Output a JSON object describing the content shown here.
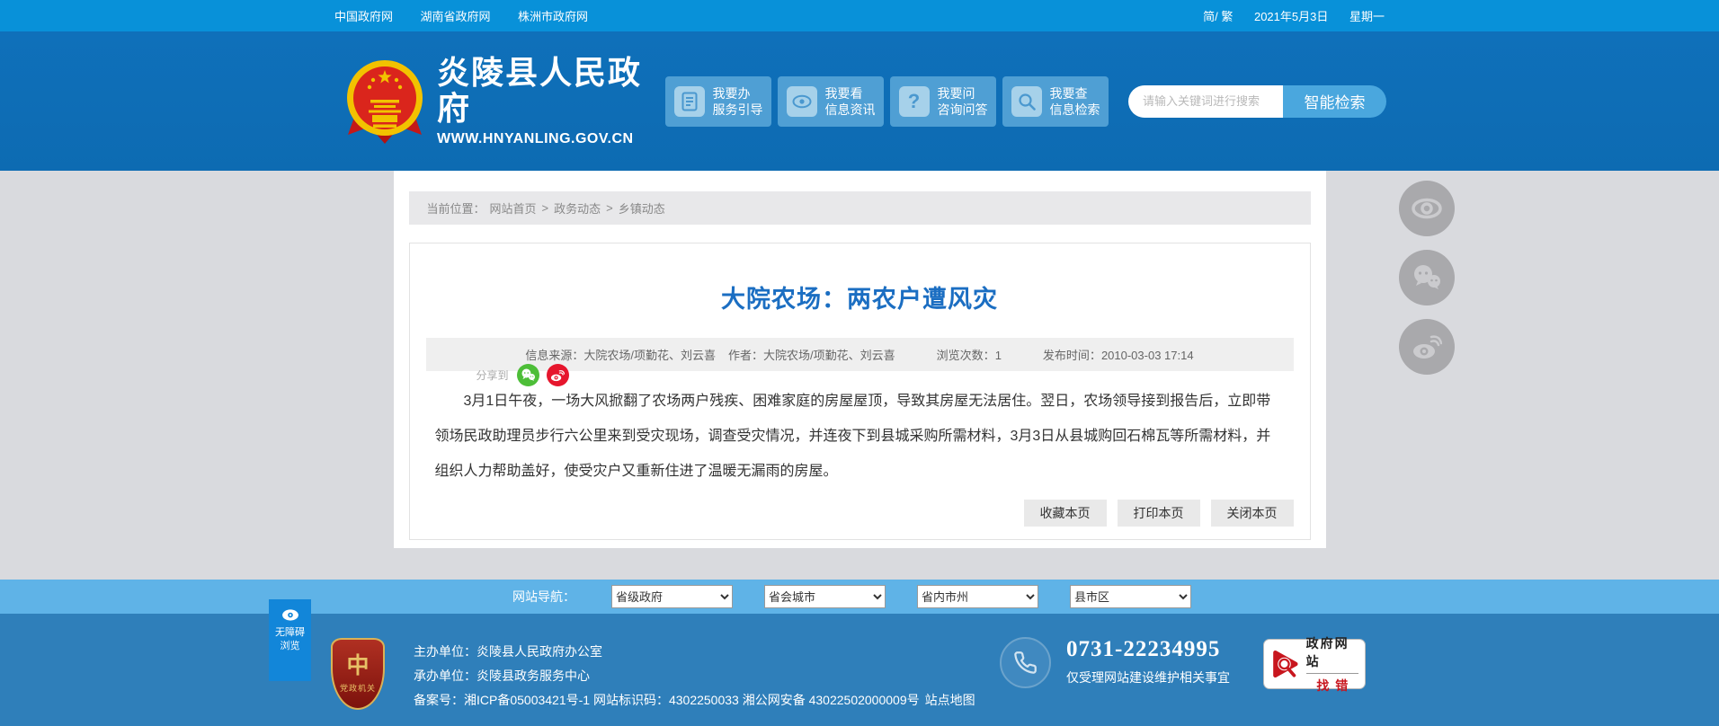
{
  "colors": {
    "topbar": "#0891d9",
    "header": "#0e6eb6",
    "navbar": "#5fb3e7",
    "footer": "#2f7fba",
    "page_bg": "#d9dade",
    "title_blue": "#1b6ec2",
    "wechat_green": "#4dbe38",
    "weibo_red": "#e6162d",
    "badge_red": "#c8161e"
  },
  "topbar": {
    "links": [
      {
        "label": "中国政府网"
      },
      {
        "label": "湖南省政府网"
      },
      {
        "label": "株洲市政府网"
      }
    ],
    "lang_toggle": "简/ 繁",
    "date": "2021年5月3日",
    "weekday": "星期一"
  },
  "header": {
    "emblem_icon": "china-national-emblem",
    "site_name": "炎陵县人民政府",
    "site_url": "WWW.HNYANLING.GOV.CN",
    "quick_buttons": [
      {
        "title": "我要办",
        "subtitle": "服务引导",
        "icon": "document-icon"
      },
      {
        "title": "我要看",
        "subtitle": "信息资讯",
        "icon": "eye-icon"
      },
      {
        "title": "我要问",
        "subtitle": "咨询问答",
        "icon": "question-icon"
      },
      {
        "title": "我要查",
        "subtitle": "信息检索",
        "icon": "search-icon"
      }
    ],
    "search": {
      "placeholder": "请输入关键词进行搜索",
      "button_label": "智能检索"
    }
  },
  "breadcrumb": {
    "label": "当前位置：",
    "separator": ">",
    "items": [
      {
        "label": "网站首页"
      },
      {
        "label": "政务动态"
      },
      {
        "label": "乡镇动态"
      }
    ]
  },
  "article": {
    "title": "大院农场：两农户遭风灾",
    "meta": {
      "source_label": "信息来源：",
      "source": "大院农场/项勤花、刘云喜",
      "author_label": "作者：",
      "author": "大院农场/项勤花、刘云喜",
      "views_label": "浏览次数：",
      "views": "1",
      "time_label": "发布时间：",
      "time": "2010-03-03 17:14"
    },
    "share_label": "分享到",
    "share_icons": [
      "wechat-icon",
      "weibo-icon"
    ],
    "body": "3月1日午夜，一场大风掀翻了农场两户残疾、困难家庭的房屋屋顶，导致其房屋无法居住。翌日，农场领导接到报告后，立即带领场民政助理员步行六公里来到受灾现场，调查受灾情况，并连夜下到县城采购所需材料，3月3日从县城购回石棉瓦等所需材料，并组织人力帮助盖好，使受灾户又重新住进了温暖无漏雨的房屋。",
    "actions": [
      {
        "label": "收藏本页"
      },
      {
        "label": "打印本页"
      },
      {
        "label": "关闭本页"
      }
    ]
  },
  "side_tools": [
    {
      "icon": "eye-icon"
    },
    {
      "icon": "wechat-icon"
    },
    {
      "icon": "weibo-icon"
    }
  ],
  "site_nav": {
    "label": "网站导航：",
    "dropdowns": [
      {
        "value": "省级政府"
      },
      {
        "value": "省会城市"
      },
      {
        "value": "省内市州"
      },
      {
        "value": "县市区"
      }
    ]
  },
  "footer": {
    "accessibility": {
      "line1": "无障碍",
      "line2": "浏览"
    },
    "agency_badge": "党政机关",
    "organizer_label": "主办单位：",
    "organizer": "炎陵县人民政府办公室",
    "undertaker_label": "承办单位：",
    "undertaker": "炎陵县政务服务中心",
    "filing_label": "备案号：",
    "filing": "湘ICP备05003421号-1 网站标识码：4302250033 湘公网安备 43022502000009号",
    "site_map": "站点地图",
    "phone": "0731-22234995",
    "phone_note": "仅受理网站建设维护相关事宜",
    "error_badge": {
      "line1": "政府网站",
      "line2": "找错"
    }
  }
}
